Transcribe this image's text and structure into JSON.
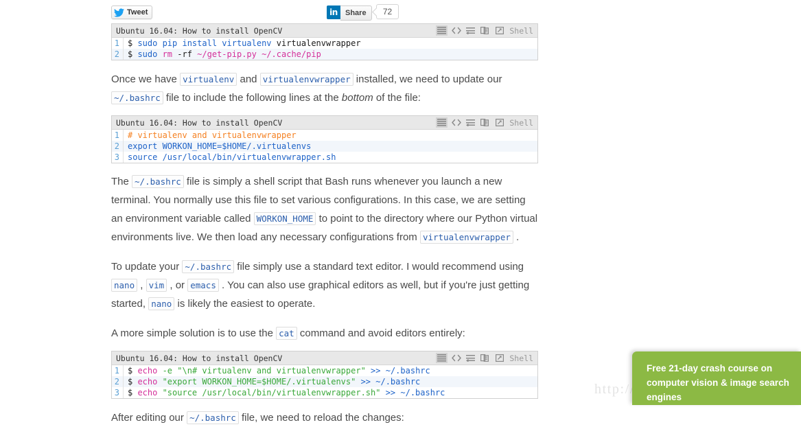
{
  "watermark": "http://blog.csdn.net/wearge",
  "social": {
    "tweet_label": "Tweet",
    "twitter_icon": "twitter-bird-icon",
    "linkedin_icon": "linkedin-in-icon",
    "linkedin_badge": "in",
    "share_label": "Share",
    "share_count": "72"
  },
  "code_blocks": [
    {
      "title": "Ubuntu 16.04: How to install OpenCV",
      "language_label": "Shell",
      "tools": [
        "toggle-line-numbers-icon",
        "view-source-icon",
        "toggle-wrap-icon",
        "copy-icon",
        "open-in-new-window-icon"
      ],
      "lines": [
        {
          "n": "1",
          "tokens": [
            {
              "t": "$ ",
              "c": "t-black"
            },
            {
              "t": "sudo pip install virtualenv ",
              "c": "t-blue"
            },
            {
              "t": "virtualenvwrapper",
              "c": "t-black"
            }
          ]
        },
        {
          "n": "2",
          "tokens": [
            {
              "t": "$ ",
              "c": "t-black"
            },
            {
              "t": "sudo ",
              "c": "t-blue"
            },
            {
              "t": "rm ",
              "c": "t-mag"
            },
            {
              "t": "-rf ",
              "c": "t-black"
            },
            {
              "t": "~/get-pip.py ~/.cache/pip",
              "c": "t-mag"
            }
          ]
        }
      ]
    },
    {
      "title": "Ubuntu 16.04: How to install OpenCV",
      "language_label": "Shell",
      "tools": [
        "toggle-line-numbers-icon",
        "view-source-icon",
        "toggle-wrap-icon",
        "copy-icon",
        "open-in-new-window-icon"
      ],
      "lines": [
        {
          "n": "1",
          "tokens": [
            {
              "t": "# virtualenv and virtualenvwrapper",
              "c": "t-orange"
            }
          ]
        },
        {
          "n": "2",
          "tokens": [
            {
              "t": "export WORKON_HOME=$HOME/.virtualenvs",
              "c": "t-blue"
            }
          ]
        },
        {
          "n": "3",
          "tokens": [
            {
              "t": "source /usr/local/bin/virtualenvwrapper.sh",
              "c": "t-blue"
            }
          ]
        }
      ]
    },
    {
      "title": "Ubuntu 16.04: How to install OpenCV",
      "language_label": "Shell",
      "tools": [
        "toggle-line-numbers-icon",
        "view-source-icon",
        "toggle-wrap-icon",
        "copy-icon",
        "open-in-new-window-icon"
      ],
      "lines": [
        {
          "n": "1",
          "tokens": [
            {
              "t": "$ ",
              "c": "t-black"
            },
            {
              "t": "echo ",
              "c": "t-mag"
            },
            {
              "t": "-e ",
              "c": "t-green"
            },
            {
              "t": "\"\\n# virtualenv and virtualenvwrapper\" ",
              "c": "t-green"
            },
            {
              "t": ">> ",
              "c": "t-blue"
            },
            {
              "t": "~/.bashrc",
              "c": "t-blue"
            }
          ]
        },
        {
          "n": "2",
          "tokens": [
            {
              "t": "$ ",
              "c": "t-black"
            },
            {
              "t": "echo ",
              "c": "t-mag"
            },
            {
              "t": "\"export WORKON_HOME=$HOME/.virtualenvs\" ",
              "c": "t-green"
            },
            {
              "t": ">> ",
              "c": "t-blue"
            },
            {
              "t": "~/.bashrc",
              "c": "t-blue"
            }
          ]
        },
        {
          "n": "3",
          "tokens": [
            {
              "t": "$ ",
              "c": "t-black"
            },
            {
              "t": "echo ",
              "c": "t-mag"
            },
            {
              "t": "\"source /usr/local/bin/virtualenvwrapper.sh\" ",
              "c": "t-green"
            },
            {
              "t": ">> ",
              "c": "t-blue"
            },
            {
              "t": "~/.bashrc",
              "c": "t-blue"
            }
          ]
        }
      ]
    }
  ],
  "paragraphs": {
    "p1": {
      "a": "Once we have ",
      "code1": "virtualenv",
      "b": " and ",
      "code2": "virtualenvwrapper",
      "c": " installed, we need to update our ",
      "code3": "~/.bashrc",
      "d": " file to include the following lines at the ",
      "em": "bottom",
      "e": " of the file:"
    },
    "p2": {
      "a": "The ",
      "code1": "~/.bashrc",
      "b": " file is simply a shell script that Bash runs whenever you launch a new terminal. You normally use this file to set various configurations. In this case, we are setting an environment variable called ",
      "code2": "WORKON_HOME",
      "c": " to point to the directory where our Python virtual environments live. We then load any necessary configurations from ",
      "code3": "virtualenvwrapper",
      "d": " ."
    },
    "p3": {
      "a": "To update your ",
      "code1": "~/.bashrc",
      "b": " file simply use a standard text editor. I would recommend using ",
      "code2": "nano",
      "c": " , ",
      "code3": "vim",
      "d": " , or ",
      "code4": "emacs",
      "e": " . You can also use graphical editors as well, but if you're just getting started, ",
      "code5": "nano",
      "f": " is likely the easiest to operate."
    },
    "p4": {
      "a": "A more simple solution is to use the ",
      "code1": "cat",
      "b": " command and avoid editors entirely:"
    },
    "p5": {
      "a": "After editing our ",
      "code1": "~/.bashrc",
      "b": " file, we need to reload the changes:"
    }
  },
  "promo": {
    "line1": "Free 21-day crash course on",
    "line2": "computer vision & image search",
    "line3": "engines"
  }
}
